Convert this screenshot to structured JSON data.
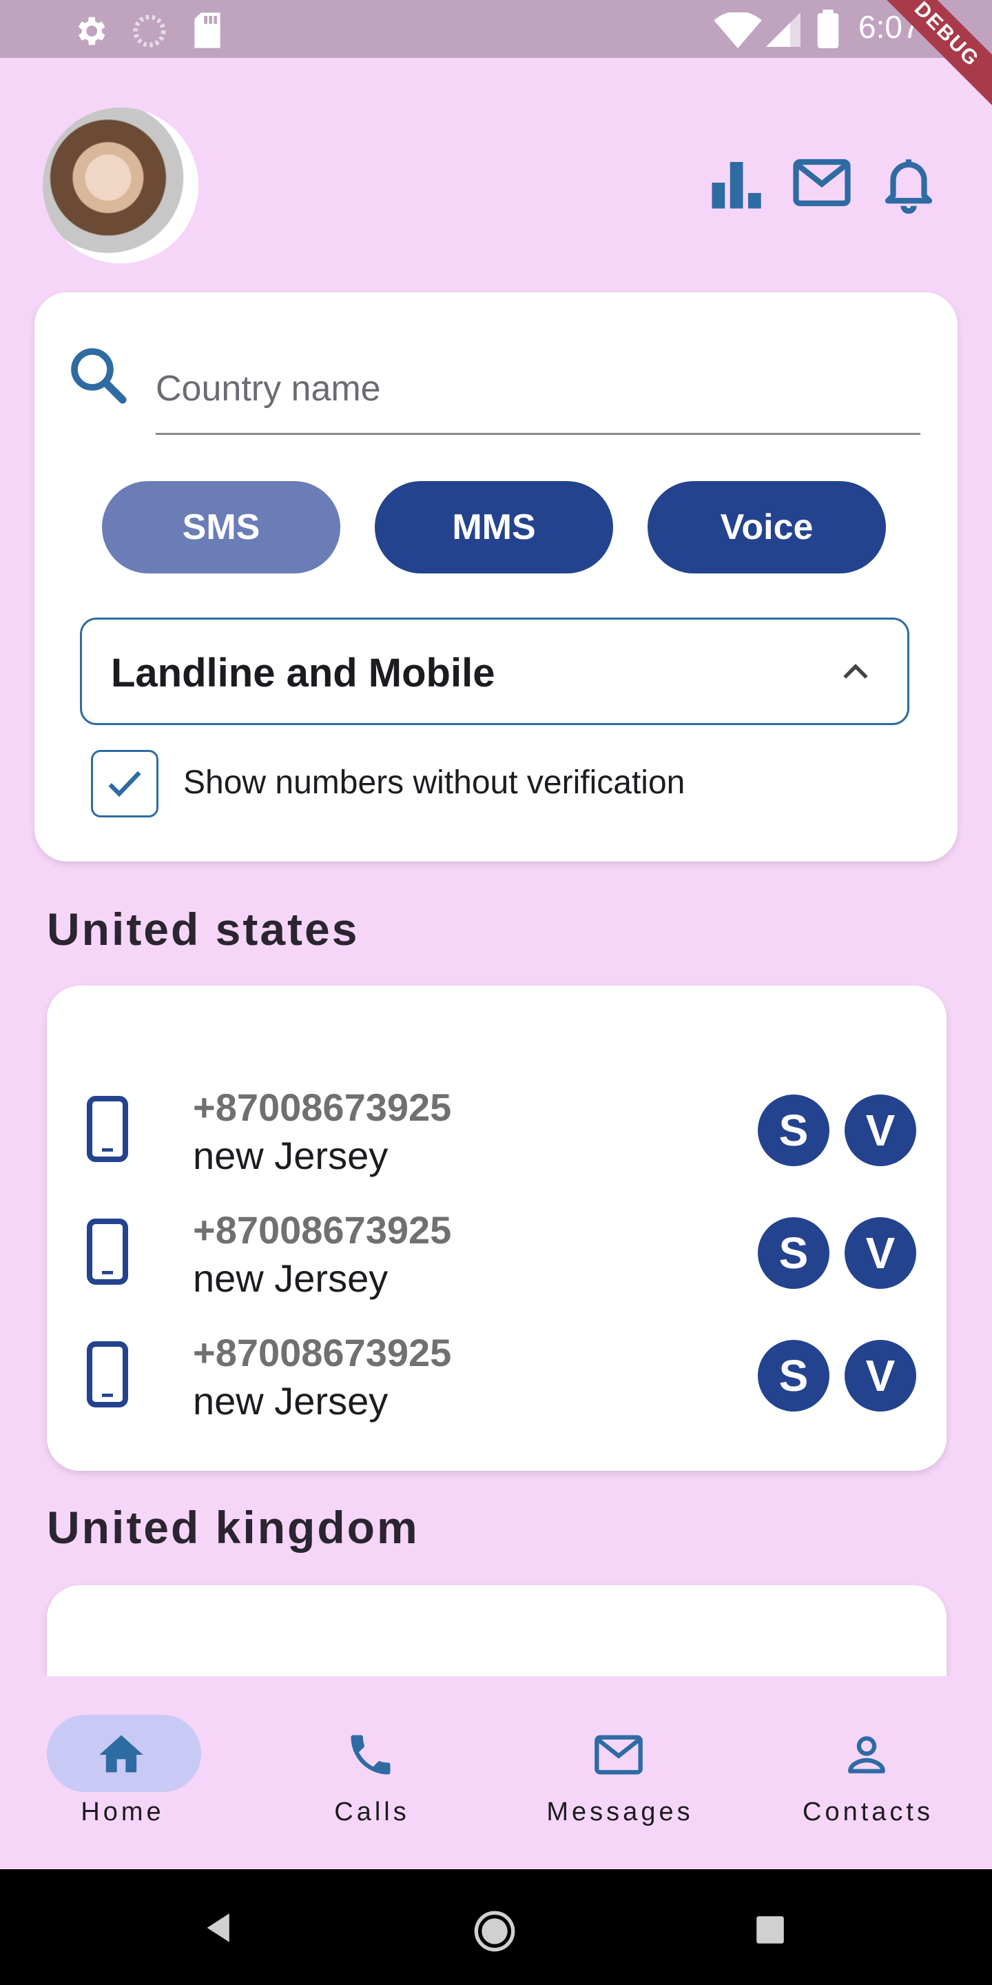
{
  "status_bar": {
    "time": "6:07",
    "debug_label": "DEBUG"
  },
  "header": {
    "avatar_label": "User avatar",
    "icons": [
      "bar-chart-icon",
      "mail-icon",
      "bell-icon"
    ]
  },
  "search": {
    "placeholder": "Country name",
    "value": "",
    "filters": [
      {
        "label": "SMS",
        "color": "#6a7db6"
      },
      {
        "label": "MMS",
        "color": "#24438f"
      },
      {
        "label": "Voice",
        "color": "#24438f"
      }
    ],
    "dropdown_value": "Landline and Mobile",
    "checkbox_checked": true,
    "checkbox_label": "Show numbers without verification"
  },
  "sections": [
    {
      "title": "United states",
      "numbers": [
        {
          "number": "+87008673925",
          "location": "new Jersey",
          "badges": [
            "S",
            "V"
          ]
        },
        {
          "number": "+87008673925",
          "location": "new Jersey",
          "badges": [
            "S",
            "V"
          ]
        },
        {
          "number": "+87008673925",
          "location": "new Jersey",
          "badges": [
            "S",
            "V"
          ]
        }
      ]
    },
    {
      "title": "United kingdom",
      "numbers": []
    }
  ],
  "bottom_nav": {
    "items": [
      {
        "label": "Home",
        "icon": "home-icon",
        "selected": true
      },
      {
        "label": "Calls",
        "icon": "phone-icon",
        "selected": false
      },
      {
        "label": "Messages",
        "icon": "mail-icon",
        "selected": false
      },
      {
        "label": "Contacts",
        "icon": "person-icon",
        "selected": false
      }
    ]
  },
  "colors": {
    "accent": "#2e6ba3",
    "primary": "#24438f",
    "background": "#f6d6f8"
  }
}
